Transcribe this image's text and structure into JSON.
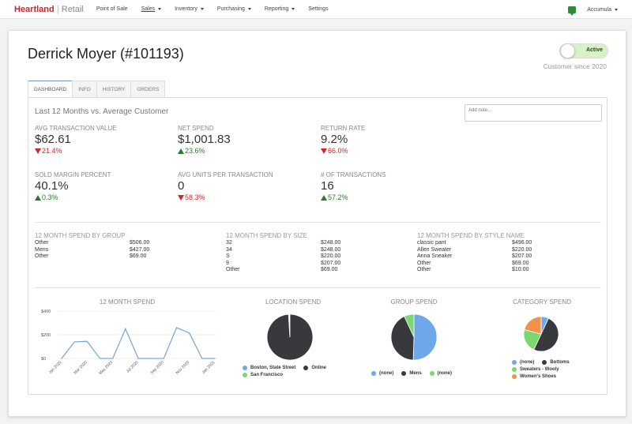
{
  "topbar": {
    "brand_primary": "Heartland",
    "brand_secondary": "Retail",
    "nav": [
      {
        "label": "Point of Sale",
        "dropdown": false,
        "active": false
      },
      {
        "label": "Sales",
        "dropdown": true,
        "active": true
      },
      {
        "label": "Inventory",
        "dropdown": true,
        "active": false
      },
      {
        "label": "Purchasing",
        "dropdown": true,
        "active": false
      },
      {
        "label": "Reporting",
        "dropdown": true,
        "active": false
      },
      {
        "label": "Settings",
        "dropdown": false,
        "active": false
      }
    ],
    "user": "Accumula",
    "chat_icon": "chat-bubble-icon"
  },
  "customer": {
    "title": "Derrick Moyer (#101193)",
    "status_toggle": "Active",
    "since": "Customer since 2020"
  },
  "tabs": [
    {
      "label": "DASHBOARD",
      "active": true
    },
    {
      "label": "INFO",
      "active": false
    },
    {
      "label": "HISTORY",
      "active": false
    },
    {
      "label": "ORDERS",
      "active": false
    }
  ],
  "dashboard": {
    "subtitle": "Last 12 Months vs. Average Customer",
    "note_placeholder": "Add note...",
    "metrics": [
      {
        "label": "AVG TRANSACTION VALUE",
        "value": "$62.61",
        "change": "21.4%",
        "direction": "down"
      },
      {
        "label": "NET SPEND",
        "value": "$1,001.83",
        "change": "23.6%",
        "direction": "up"
      },
      {
        "label": "RETURN RATE",
        "value": "9.2%",
        "change": "66.0%",
        "direction": "down"
      },
      {
        "label": "SOLD MARGIN PERCENT",
        "value": "40.1%",
        "change": "0.3%",
        "direction": "up"
      },
      {
        "label": "AVG UNITS PER TRANSACTION",
        "value": "0",
        "change": "58.3%",
        "direction": "down"
      },
      {
        "label": "# OF TRANSACTIONS",
        "value": "16",
        "change": "57.2%",
        "direction": "up"
      }
    ],
    "spend_tables": [
      {
        "title": "12 MONTH SPEND BY GROUP",
        "rows": [
          {
            "name": "Other",
            "amount": "$506.00"
          },
          {
            "name": "Mens",
            "amount": "$427.00"
          },
          {
            "name": "Other",
            "amount": "$69.00"
          }
        ]
      },
      {
        "title": "12 MONTH SPEND BY SIZE",
        "rows": [
          {
            "name": "32",
            "amount": "$248.00"
          },
          {
            "name": "34",
            "amount": "$248.00"
          },
          {
            "name": "S",
            "amount": "$220.00"
          },
          {
            "name": "9",
            "amount": "$207.00"
          },
          {
            "name": "Other",
            "amount": "$69.00"
          }
        ]
      },
      {
        "title": "12 MONTH SPEND BY STYLE NAME",
        "rows": [
          {
            "name": "classic pant",
            "amount": "$496.00"
          },
          {
            "name": "Allen Sweater",
            "amount": "$220.00"
          },
          {
            "name": "Anna Sneaker",
            "amount": "$207.00"
          },
          {
            "name": "Other",
            "amount": "$69.00"
          },
          {
            "name": "Other",
            "amount": "$10.00"
          }
        ]
      }
    ]
  },
  "chart_data": [
    {
      "type": "line",
      "title": "12 MONTH SPEND",
      "x": [
        "Jan 2020",
        "Feb 2020",
        "Mar 2020",
        "Apr 2020",
        "May 2020",
        "Jun 2020",
        "Jul 2020",
        "Aug 2020",
        "Sep 2020",
        "Oct 2020",
        "Nov 2020",
        "Dec 2020",
        "Jan 2021"
      ],
      "xtick_labels": [
        "Jan 2020",
        "Mar 2020",
        "May 2020",
        "Jul 2020",
        "Sep 2020",
        "Nov 2020",
        "Jan 2021"
      ],
      "values": [
        0,
        140,
        145,
        0,
        0,
        250,
        0,
        0,
        0,
        260,
        215,
        0,
        0
      ],
      "ytick_labels": [
        "$0",
        "$200",
        "$400"
      ],
      "ylim": [
        0,
        400
      ],
      "color": "#7ea8d6",
      "grid": true
    },
    {
      "type": "pie",
      "title": "LOCATION SPEND",
      "slices": [
        {
          "label": "Boston, State Street",
          "value": 0.5,
          "color": "#6ea8e8"
        },
        {
          "label": "Online",
          "value": 99,
          "color": "#38393c"
        },
        {
          "label": "San Francisco",
          "value": 0.5,
          "color": "#7ad86e"
        }
      ]
    },
    {
      "type": "pie",
      "title": "GROUP SPEND",
      "slices": [
        {
          "label": "(none)",
          "value": 50.5,
          "color": "#6ea8e8"
        },
        {
          "label": "Mens",
          "value": 42.6,
          "color": "#38393c"
        },
        {
          "label": "(none)",
          "value": 6.9,
          "color": "#7ad86e"
        }
      ]
    },
    {
      "type": "pie",
      "title": "CATEGORY SPEND",
      "slices": [
        {
          "label": "(none)",
          "value": 7,
          "color": "#6ea8e8"
        },
        {
          "label": "Bottoms",
          "value": 50,
          "color": "#38393c"
        },
        {
          "label": "Sweaters - Wooly",
          "value": 22,
          "color": "#7ad86e"
        },
        {
          "label": "Women's Shoes",
          "value": 21,
          "color": "#f0924a"
        }
      ]
    }
  ]
}
